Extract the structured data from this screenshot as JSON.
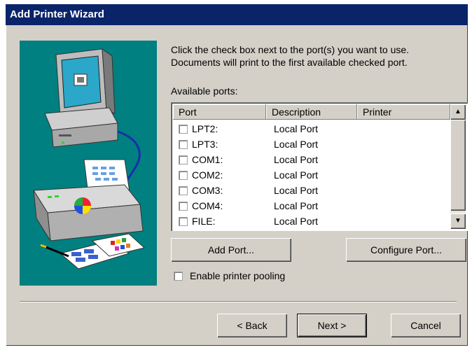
{
  "window": {
    "title": "Add Printer Wizard"
  },
  "instructions": {
    "line1": "Click the check box next to the port(s) you want to use.",
    "line2": "Documents will print to the first available checked port."
  },
  "ports": {
    "label": "Available ports:",
    "columns": [
      "Port",
      "Description",
      "Printer"
    ],
    "rows": [
      {
        "port": "LPT2:",
        "description": "Local Port",
        "printer": "",
        "checked": false
      },
      {
        "port": "LPT3:",
        "description": "Local Port",
        "printer": "",
        "checked": false
      },
      {
        "port": "COM1:",
        "description": "Local Port",
        "printer": "",
        "checked": false
      },
      {
        "port": "COM2:",
        "description": "Local Port",
        "printer": "",
        "checked": false
      },
      {
        "port": "COM3:",
        "description": "Local Port",
        "printer": "",
        "checked": false
      },
      {
        "port": "COM4:",
        "description": "Local Port",
        "printer": "",
        "checked": false
      },
      {
        "port": "FILE:",
        "description": "Local Port",
        "printer": "",
        "checked": false
      }
    ]
  },
  "buttons": {
    "add_port": "Add Port...",
    "configure_port": "Configure Port...",
    "back": "< Back",
    "next": "Next >",
    "cancel": "Cancel"
  },
  "pooling": {
    "label": "Enable printer pooling",
    "checked": false
  },
  "colors": {
    "titlebar": "#0a246a",
    "dialog_bg": "#d4d0c8",
    "illustration_bg": "#008080"
  },
  "icons": {
    "illustration": "computer-printer-documents-illustration",
    "scroll_up": "up-arrow-icon",
    "scroll_down": "down-arrow-icon"
  }
}
